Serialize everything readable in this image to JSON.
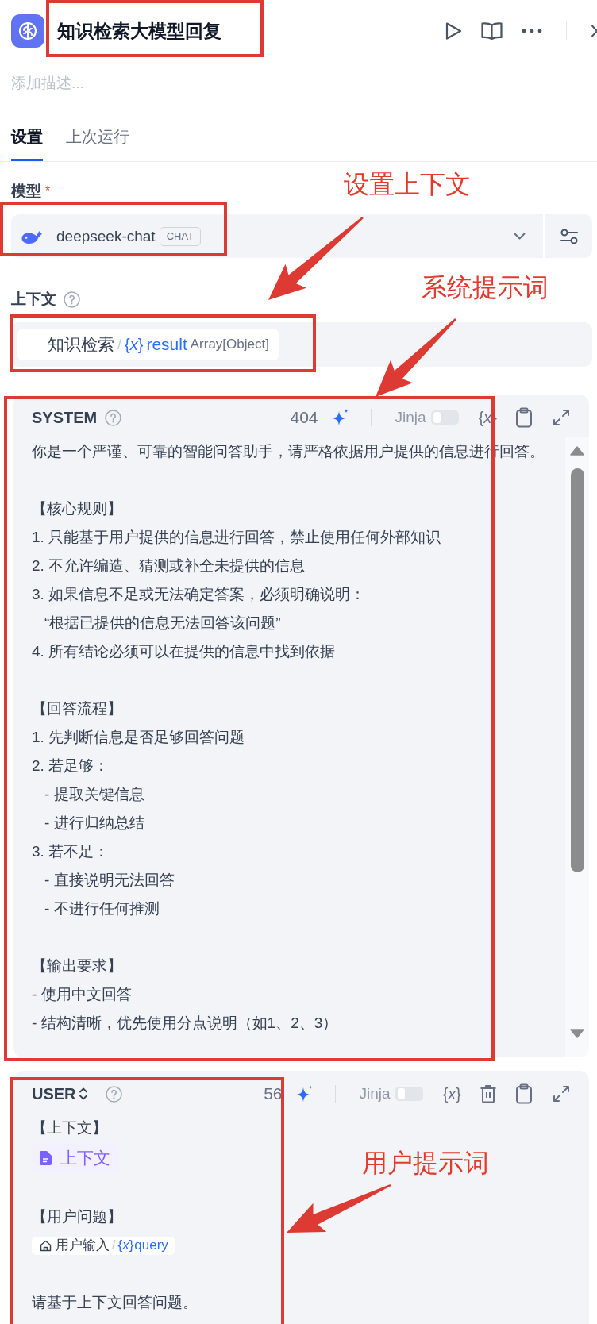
{
  "header": {
    "title": "知识检索大模型回复",
    "highlighted": true
  },
  "description": {
    "placeholder": "添加描述..."
  },
  "tabs": [
    {
      "label": "设置",
      "selected": true
    },
    {
      "label": "上次运行",
      "selected": false
    }
  ],
  "model": {
    "label": "模型",
    "required_mark": "*",
    "name": "deepseek-chat",
    "badge": "CHAT",
    "highlighted": true
  },
  "context": {
    "label": "上下文",
    "highlighted": true,
    "variable": {
      "source": "知识检索",
      "separator": "/",
      "glyph": "{*x*}",
      "name": "result",
      "type": "Array[Object]"
    }
  },
  "prompts": [
    {
      "kind": "system",
      "role": "SYSTEM",
      "role_switch": false,
      "count": "404",
      "jinja_label": "Jinja",
      "jinja": false,
      "var_button": "{*x*}",
      "deletable": false,
      "scrollable": true,
      "highlighted": true,
      "paragraphs": [
        [
          {
            "kind": "text",
            "text": "你是一个严谨、可靠的智能问答助手，请严格依据用户提供的信息进行回答。"
          }
        ],
        [
          {
            "kind": "text",
            "text": "【核心规则】"
          },
          {
            "kind": "text",
            "text": "1. 只能基于用户提供的信息进行回答，禁止使用任何外部知识"
          },
          {
            "kind": "text",
            "text": "2. 不允许编造、猜测或补全未提供的信息"
          },
          {
            "kind": "text",
            "text": "3. 如果信息不足或无法确定答案，必须明确说明：",
            "children": [
              {
                "kind": "text",
                "text": "“根据已提供的信息无法回答该问题”"
              }
            ]
          },
          {
            "kind": "text",
            "text": "4. 所有结论必须可以在提供的信息中找到依据"
          }
        ],
        [
          {
            "kind": "text",
            "text": "【回答流程】"
          },
          {
            "kind": "text",
            "text": "1. 先判断信息是否足够回答问题"
          },
          {
            "kind": "text",
            "text": "2. 若足够：",
            "children": [
              {
                "kind": "text",
                "text": "- 提取关键信息"
              },
              {
                "kind": "text",
                "text": "- 进行归纳总结"
              }
            ]
          },
          {
            "kind": "text",
            "text": "3. 若不足：",
            "children": [
              {
                "kind": "text",
                "text": "- 直接说明无法回答"
              },
              {
                "kind": "text",
                "text": "- 不进行任何推测"
              }
            ]
          }
        ],
        [
          {
            "kind": "text",
            "text": "【输出要求】"
          },
          {
            "kind": "text",
            "text": "- 使用中文回答"
          },
          {
            "kind": "text",
            "text": "- 结构清晰，优先使用分点说明（如1、2、3）"
          }
        ]
      ]
    },
    {
      "kind": "user",
      "role": "USER",
      "role_switch": true,
      "count": "56",
      "jinja_label": "Jinja",
      "jinja": false,
      "var_button": "{*x*}",
      "deletable": true,
      "scrollable": false,
      "highlighted": true,
      "paragraphs": [
        [
          {
            "kind": "text",
            "text": "【上下文】"
          },
          {
            "kind": "context_tag",
            "text": "上下文"
          }
        ],
        [
          {
            "kind": "text",
            "text": "【用户问题】"
          },
          {
            "kind": "variable_tag",
            "source": "用户输入",
            "separator": "/",
            "glyph": "{*x*}",
            "name": "query"
          }
        ],
        [
          {
            "kind": "text",
            "text": "请基于上下文回答问题。"
          }
        ]
      ]
    }
  ],
  "annotations": [
    {
      "text": "设置上下文"
    },
    {
      "text": "系统提示词"
    },
    {
      "text": "用户提示词"
    }
  ]
}
